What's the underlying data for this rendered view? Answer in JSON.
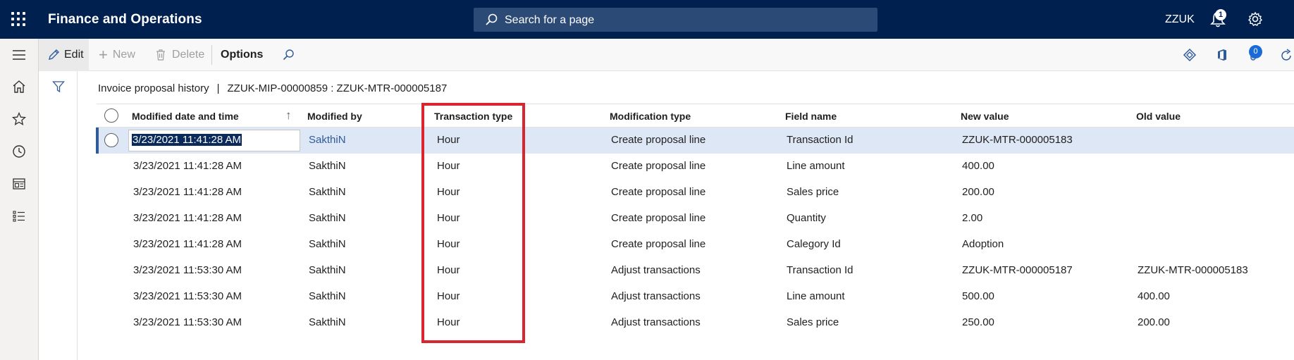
{
  "header": {
    "app_title": "Finance and Operations",
    "search_placeholder": "Search for a page",
    "company": "ZZUK",
    "notification_count": "1"
  },
  "action_pane": {
    "edit_label": "Edit",
    "new_label": "New",
    "delete_label": "Delete",
    "options_label": "Options",
    "badge_count": "0"
  },
  "breadcrumb": {
    "page": "Invoice proposal history",
    "separator": "|",
    "context": "ZZUK-MIP-00000859 : ZZUK-MTR-000005187"
  },
  "grid": {
    "columns": [
      "Modified date and time",
      "Modified by",
      "Transaction type",
      "Modification type",
      "Field name",
      "New value",
      "Old value"
    ],
    "rows": [
      {
        "date": "3/23/2021 11:41:28 AM",
        "by": "SakthiN",
        "ttype": "Hour",
        "mtype": "Create proposal line",
        "field": "Transaction Id",
        "new": "ZZUK-MTR-000005183",
        "old": ""
      },
      {
        "date": "3/23/2021 11:41:28 AM",
        "by": "SakthiN",
        "ttype": "Hour",
        "mtype": "Create proposal line",
        "field": "Line amount",
        "new": "400.00",
        "old": ""
      },
      {
        "date": "3/23/2021 11:41:28 AM",
        "by": "SakthiN",
        "ttype": "Hour",
        "mtype": "Create proposal line",
        "field": "Sales price",
        "new": "200.00",
        "old": ""
      },
      {
        "date": "3/23/2021 11:41:28 AM",
        "by": "SakthiN",
        "ttype": "Hour",
        "mtype": "Create proposal line",
        "field": "Quantity",
        "new": "2.00",
        "old": ""
      },
      {
        "date": "3/23/2021 11:41:28 AM",
        "by": "SakthiN",
        "ttype": "Hour",
        "mtype": "Create proposal line",
        "field": "Calegory Id",
        "new": "Adoption",
        "old": ""
      },
      {
        "date": "3/23/2021 11:53:30 AM",
        "by": "SakthiN",
        "ttype": "Hour",
        "mtype": "Adjust transactions",
        "field": "Transaction Id",
        "new": "ZZUK-MTR-000005187",
        "old": "ZZUK-MTR-000005183"
      },
      {
        "date": "3/23/2021 11:53:30 AM",
        "by": "SakthiN",
        "ttype": "Hour",
        "mtype": "Adjust transactions",
        "field": "Line amount",
        "new": "500.00",
        "old": "400.00"
      },
      {
        "date": "3/23/2021 11:53:30 AM",
        "by": "SakthiN",
        "ttype": "Hour",
        "mtype": "Adjust transactions",
        "field": "Sales price",
        "new": "250.00",
        "old": "200.00"
      }
    ]
  },
  "colors": {
    "header_bg": "#002050",
    "selected_row": "#dde7f6",
    "highlight_border": "#d9252f",
    "link": "#2f5b9b"
  }
}
